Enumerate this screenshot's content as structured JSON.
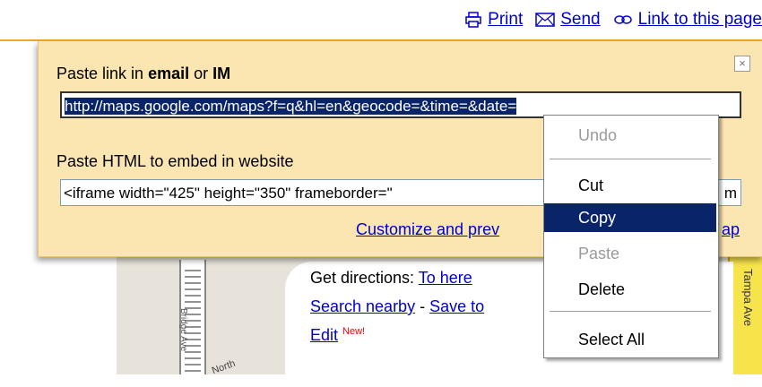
{
  "toplinks": {
    "print_label": "Print",
    "send_label": "Send",
    "link_label": "Link to this page"
  },
  "panel": {
    "email_label_prefix": "Paste link in ",
    "email_label_bold1": "email",
    "email_label_mid": " or ",
    "email_label_bold2": "IM",
    "link_value": "http://maps.google.com/maps?f=q&hl=en&geocode=&time=&date=",
    "embed_label": "Paste HTML to embed in website",
    "embed_value": "<iframe width=\"425\" height=\"350\" frameborder=\"",
    "embed_value_tail": "m",
    "customize_link": "Customize and prev",
    "customize_tail": "ap",
    "close_glyph": "×"
  },
  "bubble": {
    "directions_prefix": "Get directions: ",
    "to_here": "To here",
    "search_nearby": "Search nearby",
    "dash": " - ",
    "save_to": "Save to",
    "edit": "Edit",
    "new_tag": "New!"
  },
  "map": {
    "road_label": "Bridge Ave",
    "road_label2": "North",
    "yellow_label": "Tampa Ave"
  },
  "context_menu": {
    "items": [
      "Undo",
      "Cut",
      "Copy",
      "Paste",
      "Delete",
      "Select All"
    ],
    "active": "Copy",
    "disabled": [
      "Undo",
      "Paste"
    ]
  },
  "colors": {
    "panel_bg": "#fbe6b2",
    "accent_rule": "#f5a623",
    "selection": "#0a246a",
    "link": "#0000cc"
  }
}
